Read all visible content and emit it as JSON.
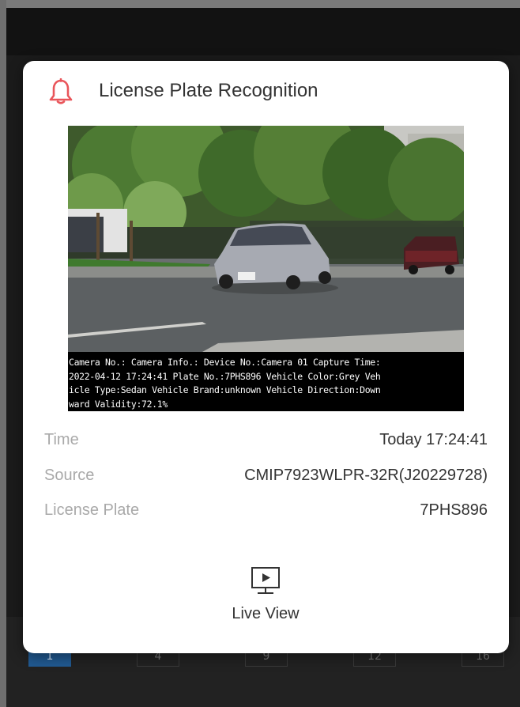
{
  "dialog": {
    "title": "License Plate Recognition",
    "header_icon": "bell-icon",
    "accent_color": "#e9555a"
  },
  "snapshot": {
    "osd_lines": [
      "Camera No.: Camera Info.: Device No.:Camera 01 Capture Time:",
      "2022-04-12 17:24:41 Plate No.:7PHS896 Vehicle Color:Grey Veh",
      "icle Type:Sedan Vehicle Brand:unknown Vehicle Direction:Down",
      "ward Validity:72.1%"
    ]
  },
  "details": [
    {
      "label": "Time",
      "value": "Today 17:24:41"
    },
    {
      "label": "Source",
      "value": "CMIP7923WLPR-32R(J20229728)"
    },
    {
      "label": "License Plate",
      "value": "7PHS896"
    }
  ],
  "actions": {
    "live_view_label": "Live View",
    "live_view_icon": "live-view-icon"
  },
  "background": {
    "pager": [
      "1",
      "4",
      "9",
      "12",
      "16"
    ]
  }
}
